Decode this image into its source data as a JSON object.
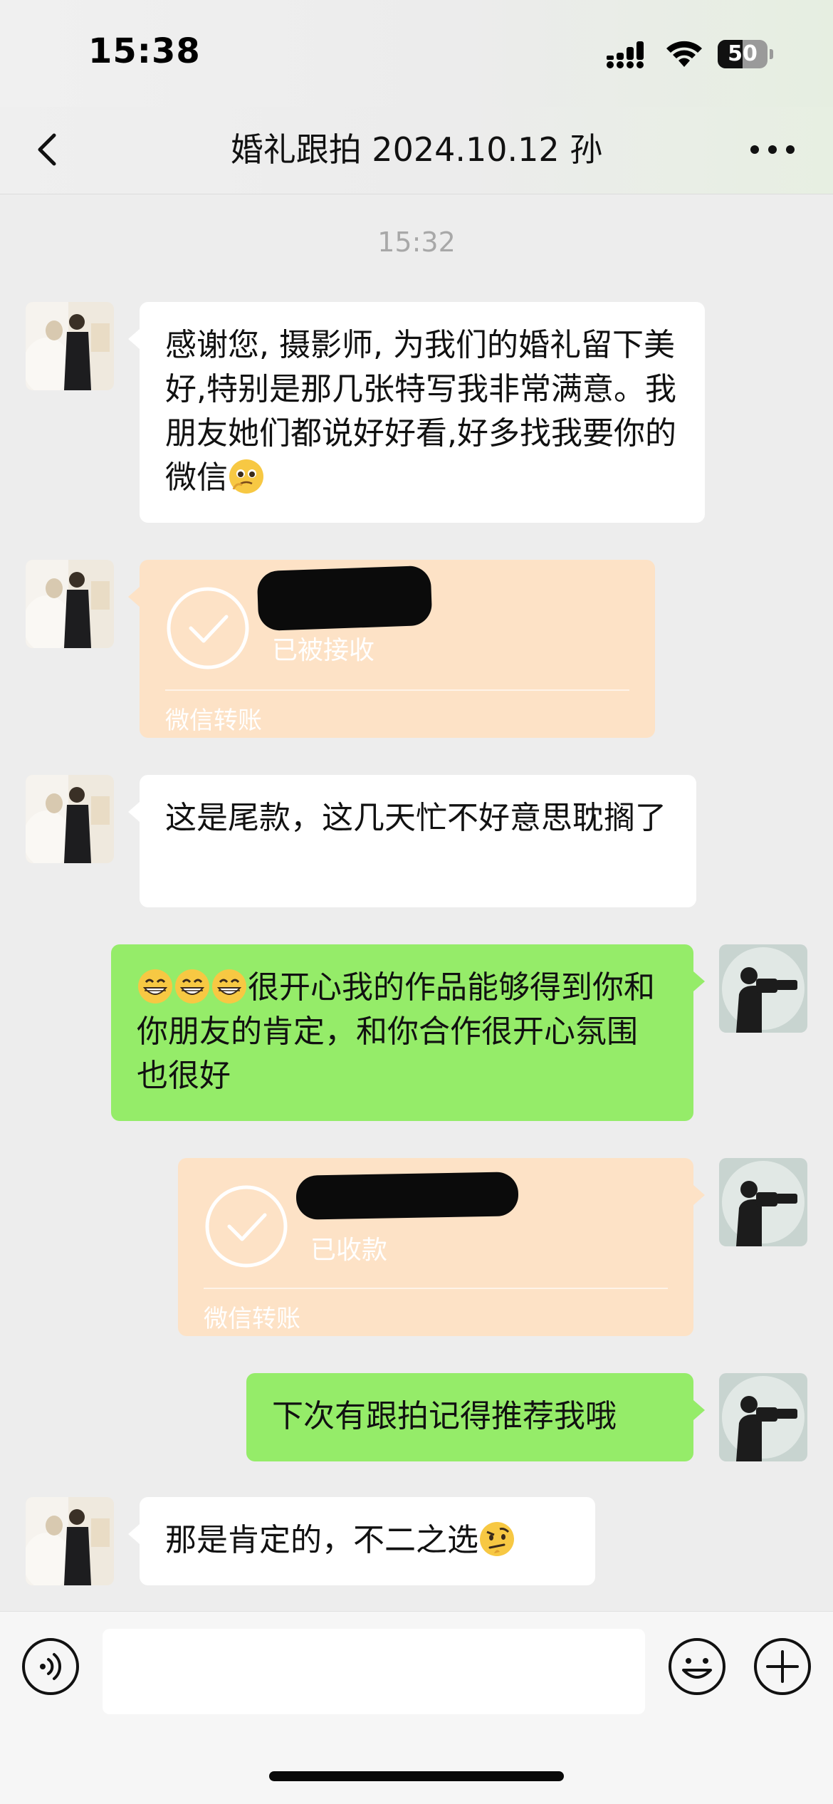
{
  "status_bar": {
    "time": "15:38",
    "battery_level": "50",
    "battery_fraction": 0.5
  },
  "nav": {
    "title": "婚礼跟拍 2024.10.12 孙",
    "back_icon": "chevron-left-icon",
    "more_icon": "ellipsis-icon"
  },
  "chat": {
    "timestamp": "15:32",
    "messages": [
      {
        "side": "in",
        "type": "text",
        "text": "感谢您, 摄影师, 为我们的婚礼留下美好,特别是那几张特写我非常满意。我朋友她们都说好好看,好多找我要你的微信",
        "trailing_emoji": "🥹"
      },
      {
        "side": "in",
        "type": "transfer",
        "status": "已被接收",
        "label": "微信转账"
      },
      {
        "side": "in",
        "type": "text",
        "text": "这是尾款，这几天忙不好意思耽搁了"
      },
      {
        "side": "out",
        "type": "text",
        "leading_emoji": "😁😁😁",
        "text": "很开心我的作品能够得到你和你朋友的肯定，和你合作很开心氛围也很好"
      },
      {
        "side": "out",
        "type": "transfer",
        "status": "已收款",
        "label": "微信转账"
      },
      {
        "side": "out",
        "type": "text",
        "text": "下次有跟拍记得推荐我哦"
      },
      {
        "side": "in",
        "type": "text",
        "text": "那是肯定的，不二之选",
        "trailing_emoji": "🤨"
      }
    ]
  },
  "input_bar": {
    "voice_icon": "voice-icon",
    "emoji_icon": "smiley-icon",
    "add_icon": "plus-icon",
    "placeholder": ""
  },
  "colors": {
    "background": "#ededed",
    "incoming_bubble": "#ffffff",
    "outgoing_bubble": "#95ec69",
    "transfer_card": "#fde2c6",
    "timestamp": "#a8a8a8"
  }
}
